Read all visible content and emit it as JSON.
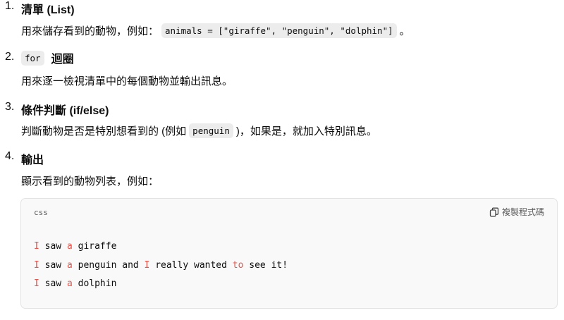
{
  "items": [
    {
      "number": "1.",
      "title": "清單 (List)",
      "desc_before": "用來儲存看到的動物，例如：",
      "desc_code": "animals = [\"giraffe\", \"penguin\", \"dolphin\"]",
      "desc_after": "。"
    },
    {
      "number": "2.",
      "title_code": "for",
      "title": "迴圈",
      "desc_before": "用來逐一檢視清單中的每個動物並輸出訊息。"
    },
    {
      "number": "3.",
      "title": "條件判斷 (if/else)",
      "desc_before": "判斷動物是否是特別想看到的 (例如",
      "desc_code": "penguin",
      "desc_after": ")，如果是，就加入特別訊息。"
    },
    {
      "number": "4.",
      "title": "輸出",
      "desc_before": "顯示看到的動物列表，例如："
    }
  ],
  "code_block": {
    "language": "css",
    "copy_label": "複製程式碼",
    "copy_icon": "copy-icon",
    "highlight_color": "#e5534b",
    "lines": [
      [
        {
          "t": "I",
          "hl": true
        },
        {
          "t": " saw "
        },
        {
          "t": "a",
          "hl": true
        },
        {
          "t": " giraffe"
        }
      ],
      [
        {
          "t": "I",
          "hl": true
        },
        {
          "t": " saw "
        },
        {
          "t": "a",
          "hl": true
        },
        {
          "t": " penguin and "
        },
        {
          "t": "I",
          "hl": true
        },
        {
          "t": " really wanted "
        },
        {
          "t": "to",
          "hl": true
        },
        {
          "t": " see it!"
        }
      ],
      [
        {
          "t": "I",
          "hl": true
        },
        {
          "t": " saw "
        },
        {
          "t": "a",
          "hl": true
        },
        {
          "t": " dolphin"
        }
      ]
    ]
  }
}
